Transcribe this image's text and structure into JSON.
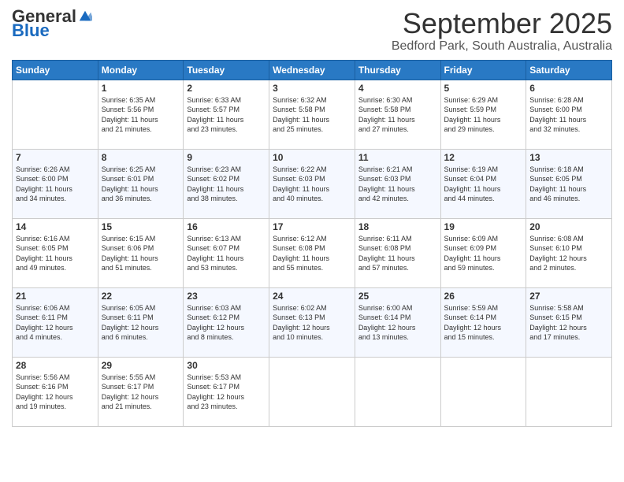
{
  "header": {
    "logo_general": "General",
    "logo_blue": "Blue",
    "month": "September 2025",
    "location": "Bedford Park, South Australia, Australia"
  },
  "days_of_week": [
    "Sunday",
    "Monday",
    "Tuesday",
    "Wednesday",
    "Thursday",
    "Friday",
    "Saturday"
  ],
  "weeks": [
    [
      {
        "day": "",
        "info": ""
      },
      {
        "day": "1",
        "info": "Sunrise: 6:35 AM\nSunset: 5:56 PM\nDaylight: 11 hours\nand 21 minutes."
      },
      {
        "day": "2",
        "info": "Sunrise: 6:33 AM\nSunset: 5:57 PM\nDaylight: 11 hours\nand 23 minutes."
      },
      {
        "day": "3",
        "info": "Sunrise: 6:32 AM\nSunset: 5:58 PM\nDaylight: 11 hours\nand 25 minutes."
      },
      {
        "day": "4",
        "info": "Sunrise: 6:30 AM\nSunset: 5:58 PM\nDaylight: 11 hours\nand 27 minutes."
      },
      {
        "day": "5",
        "info": "Sunrise: 6:29 AM\nSunset: 5:59 PM\nDaylight: 11 hours\nand 29 minutes."
      },
      {
        "day": "6",
        "info": "Sunrise: 6:28 AM\nSunset: 6:00 PM\nDaylight: 11 hours\nand 32 minutes."
      }
    ],
    [
      {
        "day": "7",
        "info": "Sunrise: 6:26 AM\nSunset: 6:00 PM\nDaylight: 11 hours\nand 34 minutes."
      },
      {
        "day": "8",
        "info": "Sunrise: 6:25 AM\nSunset: 6:01 PM\nDaylight: 11 hours\nand 36 minutes."
      },
      {
        "day": "9",
        "info": "Sunrise: 6:23 AM\nSunset: 6:02 PM\nDaylight: 11 hours\nand 38 minutes."
      },
      {
        "day": "10",
        "info": "Sunrise: 6:22 AM\nSunset: 6:03 PM\nDaylight: 11 hours\nand 40 minutes."
      },
      {
        "day": "11",
        "info": "Sunrise: 6:21 AM\nSunset: 6:03 PM\nDaylight: 11 hours\nand 42 minutes."
      },
      {
        "day": "12",
        "info": "Sunrise: 6:19 AM\nSunset: 6:04 PM\nDaylight: 11 hours\nand 44 minutes."
      },
      {
        "day": "13",
        "info": "Sunrise: 6:18 AM\nSunset: 6:05 PM\nDaylight: 11 hours\nand 46 minutes."
      }
    ],
    [
      {
        "day": "14",
        "info": "Sunrise: 6:16 AM\nSunset: 6:05 PM\nDaylight: 11 hours\nand 49 minutes."
      },
      {
        "day": "15",
        "info": "Sunrise: 6:15 AM\nSunset: 6:06 PM\nDaylight: 11 hours\nand 51 minutes."
      },
      {
        "day": "16",
        "info": "Sunrise: 6:13 AM\nSunset: 6:07 PM\nDaylight: 11 hours\nand 53 minutes."
      },
      {
        "day": "17",
        "info": "Sunrise: 6:12 AM\nSunset: 6:08 PM\nDaylight: 11 hours\nand 55 minutes."
      },
      {
        "day": "18",
        "info": "Sunrise: 6:11 AM\nSunset: 6:08 PM\nDaylight: 11 hours\nand 57 minutes."
      },
      {
        "day": "19",
        "info": "Sunrise: 6:09 AM\nSunset: 6:09 PM\nDaylight: 11 hours\nand 59 minutes."
      },
      {
        "day": "20",
        "info": "Sunrise: 6:08 AM\nSunset: 6:10 PM\nDaylight: 12 hours\nand 2 minutes."
      }
    ],
    [
      {
        "day": "21",
        "info": "Sunrise: 6:06 AM\nSunset: 6:11 PM\nDaylight: 12 hours\nand 4 minutes."
      },
      {
        "day": "22",
        "info": "Sunrise: 6:05 AM\nSunset: 6:11 PM\nDaylight: 12 hours\nand 6 minutes."
      },
      {
        "day": "23",
        "info": "Sunrise: 6:03 AM\nSunset: 6:12 PM\nDaylight: 12 hours\nand 8 minutes."
      },
      {
        "day": "24",
        "info": "Sunrise: 6:02 AM\nSunset: 6:13 PM\nDaylight: 12 hours\nand 10 minutes."
      },
      {
        "day": "25",
        "info": "Sunrise: 6:00 AM\nSunset: 6:14 PM\nDaylight: 12 hours\nand 13 minutes."
      },
      {
        "day": "26",
        "info": "Sunrise: 5:59 AM\nSunset: 6:14 PM\nDaylight: 12 hours\nand 15 minutes."
      },
      {
        "day": "27",
        "info": "Sunrise: 5:58 AM\nSunset: 6:15 PM\nDaylight: 12 hours\nand 17 minutes."
      }
    ],
    [
      {
        "day": "28",
        "info": "Sunrise: 5:56 AM\nSunset: 6:16 PM\nDaylight: 12 hours\nand 19 minutes."
      },
      {
        "day": "29",
        "info": "Sunrise: 5:55 AM\nSunset: 6:17 PM\nDaylight: 12 hours\nand 21 minutes."
      },
      {
        "day": "30",
        "info": "Sunrise: 5:53 AM\nSunset: 6:17 PM\nDaylight: 12 hours\nand 23 minutes."
      },
      {
        "day": "",
        "info": ""
      },
      {
        "day": "",
        "info": ""
      },
      {
        "day": "",
        "info": ""
      },
      {
        "day": "",
        "info": ""
      }
    ]
  ]
}
